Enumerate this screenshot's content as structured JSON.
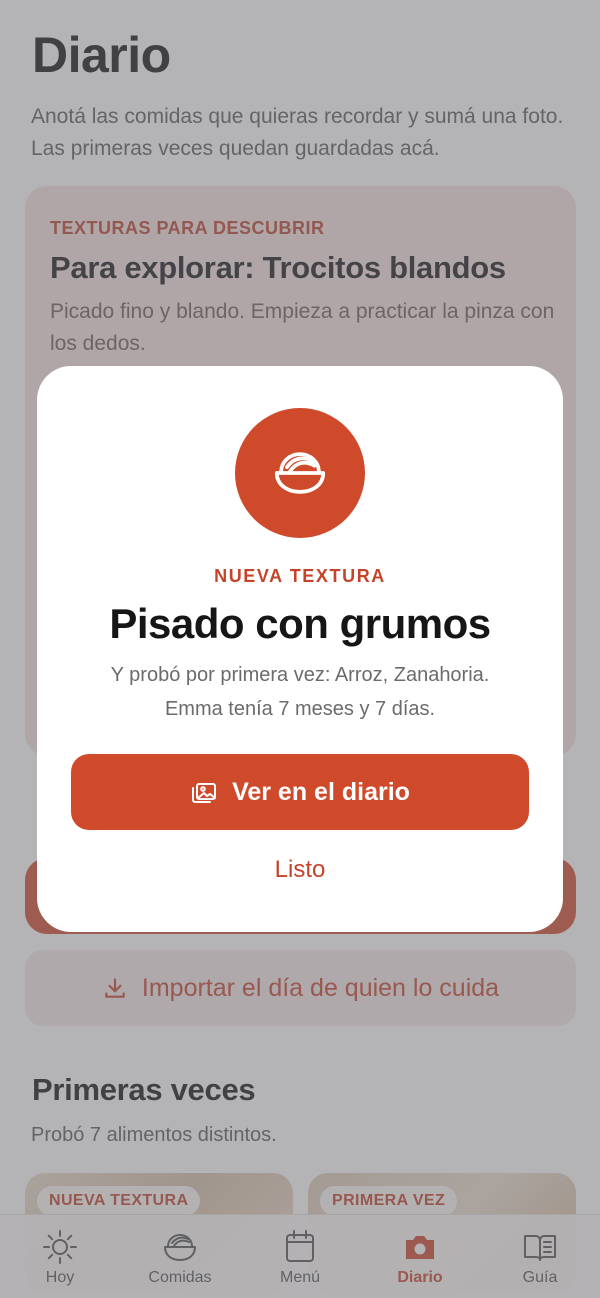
{
  "page": {
    "title": "Diario",
    "description": "Anotá las comidas que quieras recordar y sumá una foto. Las primeras veces quedan guardadas acá."
  },
  "texture_card": {
    "kicker": "TEXTURAS PARA DESCUBRIR",
    "title": "Para explorar: Trocitos blandos",
    "description": "Picado fino y blando. Empieza a practicar la pinza con los dedos."
  },
  "import_button": {
    "label": "Importar el día de quien lo cuida",
    "icon": "download-icon"
  },
  "first_times": {
    "title": "Primeras veces",
    "subtitle": "Probó 7 alimentos distintos.",
    "cards": [
      {
        "badge": "NUEVA TEXTURA"
      },
      {
        "badge": "PRIMERA VEZ"
      }
    ]
  },
  "tabbar": {
    "tabs": [
      {
        "label": "Hoy",
        "icon": "sun-icon",
        "active": false
      },
      {
        "label": "Comidas",
        "icon": "bowl-icon",
        "active": false
      },
      {
        "label": "Menú",
        "icon": "calendar-icon",
        "active": false
      },
      {
        "label": "Diario",
        "icon": "camera-icon",
        "active": true
      },
      {
        "label": "Guía",
        "icon": "book-icon",
        "active": false
      }
    ]
  },
  "modal": {
    "icon": "bowl-icon",
    "kicker": "NUEVA TEXTURA",
    "title": "Pisado con grumos",
    "body_line1": "Y probó por primera vez: Arroz, Zanahoria.",
    "body_line2": "Emma tenía 7 meses y 7 días.",
    "primary_label": "Ver en el diario",
    "primary_icon": "images-icon",
    "secondary_label": "Listo"
  },
  "colors": {
    "accent": "#cf4a2b",
    "accent_text": "#c6432a",
    "overlay": "#6e6e76"
  }
}
